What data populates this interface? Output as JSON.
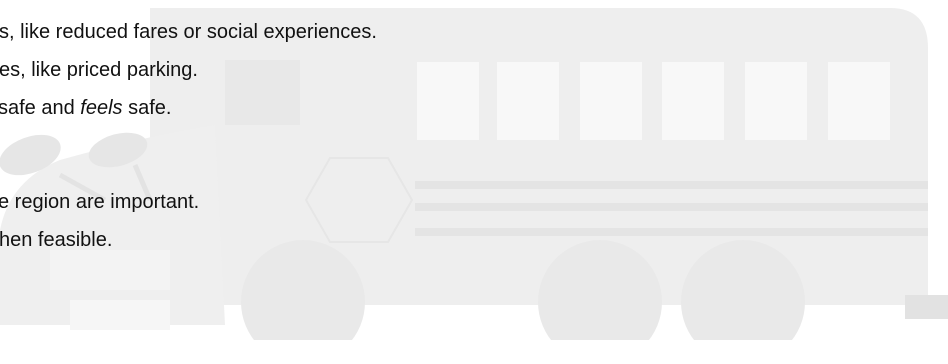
{
  "slide": {
    "lines": [
      {
        "text": "s, like reduced fares or social experiences."
      },
      {
        "text": "es, like priced parking."
      },
      {
        "before": "safe and ",
        "emphasis": "feels",
        "after": " safe."
      },
      {
        "text": "e region are important."
      },
      {
        "text": "hen feasible."
      }
    ]
  },
  "background": {
    "image": "school-bus-watermark",
    "color": "#eeeeee",
    "window_color": "#f7f7f7"
  }
}
